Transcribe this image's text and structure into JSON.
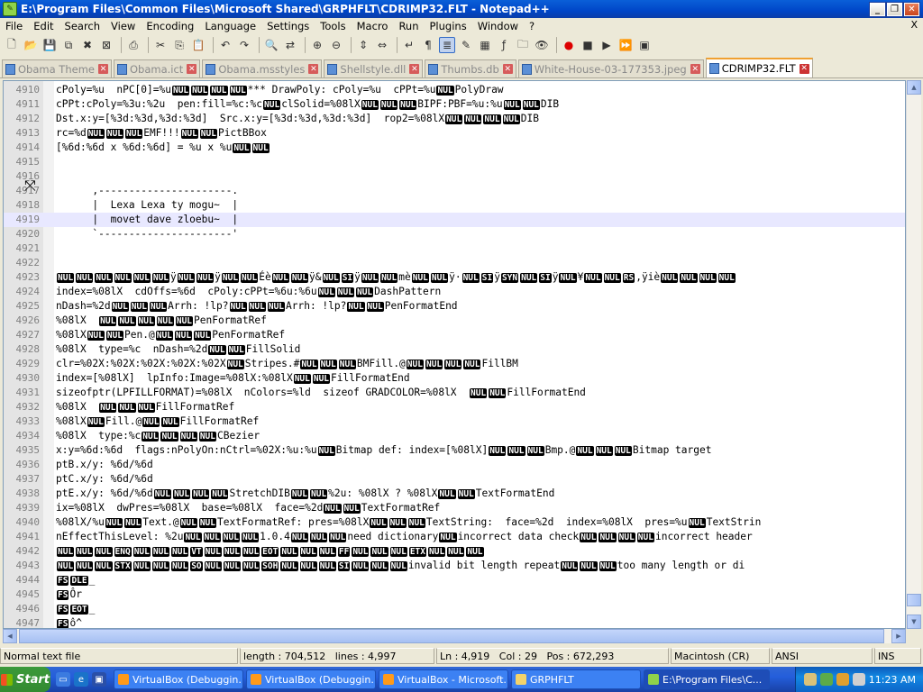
{
  "window": {
    "title": "E:\\Program Files\\Common Files\\Microsoft Shared\\GRPHFLT\\CDRIMP32.FLT - Notepad++",
    "minimize": "_",
    "restore": "❐",
    "close": "✕"
  },
  "menu": {
    "items": [
      "File",
      "Edit",
      "Search",
      "View",
      "Encoding",
      "Language",
      "Settings",
      "Tools",
      "Macro",
      "Run",
      "Plugins",
      "Window",
      "?"
    ],
    "close": "X"
  },
  "toolbar": {
    "icons": [
      "new-file-icon",
      "open-file-icon",
      "save-icon",
      "save-all-icon",
      "close-icon",
      "close-all-icon",
      "print-icon",
      "cut-icon",
      "copy-icon",
      "paste-icon",
      "undo-icon",
      "redo-icon",
      "find-icon",
      "replace-icon",
      "zoom-in-icon",
      "zoom-out-icon",
      "sync-v-icon",
      "sync-h-icon",
      "wrap-icon",
      "all-chars-icon",
      "indent-guide-icon",
      "udl-icon",
      "doc-map-icon",
      "function-list-icon",
      "folder-workspace-icon",
      "monitor-icon",
      "record-macro-icon",
      "stop-macro-icon",
      "play-macro-icon",
      "run-macro-multiple-icon",
      "save-macro-icon"
    ]
  },
  "tabs": [
    {
      "label": "Obama Theme",
      "active": false
    },
    {
      "label": "Obama.ict",
      "active": false
    },
    {
      "label": "Obama.msstyles",
      "active": false
    },
    {
      "label": "Shellstyle.dll",
      "active": false
    },
    {
      "label": "Thumbs.db",
      "active": false
    },
    {
      "label": "White-House-03-177353.jpeg",
      "active": false
    },
    {
      "label": "CDRIMP32.FLT",
      "active": true
    }
  ],
  "editor": {
    "current_line": 4919,
    "lines": [
      {
        "n": "4910",
        "text": "cPoly=%u  nPC[0]=%u⟦NUL⟧⟦NUL⟧⟦NUL⟧⟦NUL⟧*** DrawPoly: cPoly=%u  cPPt=%u⟦NUL⟧PolyDraw"
      },
      {
        "n": "4911",
        "text": "cPPt:cPoly=%3u:%2u  pen:fill=%c:%c⟦NUL⟧clSolid=%08lX⟦NUL⟧⟦NUL⟧⟦NUL⟧BIPF:PBF=%u:%u⟦NUL⟧⟦NUL⟧DIB"
      },
      {
        "n": "4912",
        "text": "Dst.x:y=[%3d:%3d,%3d:%3d]  Src.x:y=[%3d:%3d,%3d:%3d]  rop2=%08lX⟦NUL⟧⟦NUL⟧⟦NUL⟧⟦NUL⟧DIB"
      },
      {
        "n": "4913",
        "text": "rc=%d⟦NUL⟧⟦NUL⟧⟦NUL⟧EMF!!!⟦NUL⟧⟦NUL⟧PictBBox"
      },
      {
        "n": "4914",
        "text": "[%6d:%6d x %6d:%6d] = %u x %u⟦NUL⟧⟦NUL⟧"
      },
      {
        "n": "4915",
        "text": ""
      },
      {
        "n": "4916",
        "text": ""
      },
      {
        "n": "4917",
        "text": "      ,----------------------."
      },
      {
        "n": "4918",
        "text": "      |  Lexa Lexa ty mogu~  |"
      },
      {
        "n": "4919",
        "text": "      |  movet dave zloebu~  |"
      },
      {
        "n": "4920",
        "text": "      `----------------------'"
      },
      {
        "n": "4921",
        "text": ""
      },
      {
        "n": "4922",
        "text": ""
      },
      {
        "n": "4923",
        "text": "⟦NUL⟧⟦NUL⟧⟦NUL⟧⟦NUL⟧⟦NUL⟧⟦NUL⟧ÿ⟦NUL⟧⟦NUL⟧ÿ⟦NUL⟧⟦NUL⟧Éè⟦NUL⟧⟦NUL⟧ÿ&⟦NUL⟧⟦SI⟧ÿ⟦NUL⟧⟦NUL⟧mè⟦NUL⟧⟦NUL⟧ÿ·⟦NUL⟧⟦SI⟧ÿ⟦SYN⟧⟦NUL⟧⟦SI⟧ÿ⟦NUL⟧¥⟦NUL⟧⟦NUL⟧⟦RS⟧,ÿiè⟦NUL⟧⟦NUL⟧⟦NUL⟧⟦NUL⟧"
      },
      {
        "n": "4924",
        "text": "index=%08lX  cdOffs=%6d  cPoly:cPPt=%6u:%6u⟦NUL⟧⟦NUL⟧⟦NUL⟧DashPattern"
      },
      {
        "n": "4925",
        "text": "nDash=%2d⟦NUL⟧⟦NUL⟧⟦NUL⟧Arrh: !lp?⟦NUL⟧⟦NUL⟧⟦NUL⟧Arrh: !lp?⟦NUL⟧⟦NUL⟧PenFormatEnd"
      },
      {
        "n": "4926",
        "text": "%08lX  ⟦NUL⟧⟦NUL⟧⟦NUL⟧⟦NUL⟧⟦NUL⟧PenFormatRef"
      },
      {
        "n": "4927",
        "text": "%08lX⟦NUL⟧⟦NUL⟧Pen.@⟦NUL⟧⟦NUL⟧⟦NUL⟧PenFormatRef"
      },
      {
        "n": "4928",
        "text": "%08lX  type=%c  nDash=%2d⟦NUL⟧⟦NUL⟧FillSolid"
      },
      {
        "n": "4929",
        "text": "clr=%02X:%02X:%02X:%02X:%02X⟦NUL⟧Stripes.#⟦NUL⟧⟦NUL⟧⟦NUL⟧BMFill.@⟦NUL⟧⟦NUL⟧⟦NUL⟧⟦NUL⟧FillBM"
      },
      {
        "n": "4930",
        "text": "index=[%08lX]  lpInfo:Image=%08lX:%08lX⟦NUL⟧⟦NUL⟧FillFormatEnd"
      },
      {
        "n": "4931",
        "text": "sizeofptr(LPFILLFORMAT)=%08lX  nColors=%ld  sizeof GRADCOLOR=%08lX  ⟦NUL⟧⟦NUL⟧FillFormatEnd"
      },
      {
        "n": "4932",
        "text": "%08lX  ⟦NUL⟧⟦NUL⟧⟦NUL⟧FillFormatRef"
      },
      {
        "n": "4933",
        "text": "%08lX⟦NUL⟧Fill.@⟦NUL⟧⟦NUL⟧FillFormatRef"
      },
      {
        "n": "4934",
        "text": "%08lX  type:%c⟦NUL⟧⟦NUL⟧⟦NUL⟧⟦NUL⟧CBezier"
      },
      {
        "n": "4935",
        "text": "x:y=%6d:%6d  flags:nPolyOn:nCtrl=%02X:%u:%u⟦NUL⟧Bitmap def: index=[%08lX]⟦NUL⟧⟦NUL⟧⟦NUL⟧Bmp.@⟦NUL⟧⟦NUL⟧⟦NUL⟧Bitmap target"
      },
      {
        "n": "4936",
        "text": "ptB.x/y: %6d/%6d"
      },
      {
        "n": "4937",
        "text": "ptC.x/y: %6d/%6d"
      },
      {
        "n": "4938",
        "text": "ptE.x/y: %6d/%6d⟦NUL⟧⟦NUL⟧⟦NUL⟧⟦NUL⟧StretchDIB⟦NUL⟧⟦NUL⟧%2u: %08lX ? %08lX⟦NUL⟧⟦NUL⟧TextFormatEnd"
      },
      {
        "n": "4939",
        "text": "ix=%08lX  dwPres=%08lX  base=%08lX  face=%2d⟦NUL⟧⟦NUL⟧TextFormatRef"
      },
      {
        "n": "4940",
        "text": "%08lX/%u⟦NUL⟧⟦NUL⟧Text.@⟦NUL⟧⟦NUL⟧TextFormatRef: pres=%08lX⟦NUL⟧⟦NUL⟧⟦NUL⟧TextString:  face=%2d  index=%08lX  pres=%u⟦NUL⟧TextStrin"
      },
      {
        "n": "4941",
        "text": "nEffectThisLevel: %2u⟦NUL⟧⟦NUL⟧⟦NUL⟧⟦NUL⟧1.0.4⟦NUL⟧⟦NUL⟧⟦NUL⟧need dictionary⟦NUL⟧incorrect data check⟦NUL⟧⟦NUL⟧⟦NUL⟧⟦NUL⟧incorrect header"
      },
      {
        "n": "4942",
        "text": "⟦NUL⟧⟦NUL⟧⟦NUL⟧⟦ENQ⟧⟦NUL⟧⟦NUL⟧⟦NUL⟧⟦VT⟧⟦NUL⟧⟦NUL⟧⟦NUL⟧⟦EOT⟧⟦NUL⟧⟦NUL⟧⟦NUL⟧⟦FF⟧⟦NUL⟧⟦NUL⟧⟦NUL⟧⟦ETX⟧⟦NUL⟧⟦NUL⟧⟦NUL⟧"
      },
      {
        "n": "4943",
        "text": "⟦NUL⟧⟦NUL⟧⟦NUL⟧⟦STX⟧⟦NUL⟧⟦NUL⟧⟦NUL⟧⟦SO⟧⟦NUL⟧⟦NUL⟧⟦NUL⟧⟦SOH⟧⟦NUL⟧⟦NUL⟧⟦NUL⟧⟦SI⟧⟦NUL⟧⟦NUL⟧⟦NUL⟧invalid bit length repeat⟦NUL⟧⟦NUL⟧⟦NUL⟧too many length or di"
      },
      {
        "n": "4944",
        "text": "⟦FS⟧⟦DLE⟧_"
      },
      {
        "n": "4945",
        "text": "⟦FS⟧Ôr"
      },
      {
        "n": "4946",
        "text": "⟦FS⟧⟦EOT⟧_"
      },
      {
        "n": "4947",
        "text": "⟦FS⟧ô^"
      }
    ]
  },
  "statusbar": {
    "file_type": "Normal text file",
    "length": "length : 704,512",
    "lines": "lines : 4,997",
    "ln": "Ln : 4,919",
    "col": "Col : 29",
    "pos": "Pos : 672,293",
    "eol": "Macintosh (CR)",
    "encoding": "ANSI",
    "mode": "INS"
  },
  "taskbar": {
    "start": "Start",
    "tasks": [
      {
        "label": "VirtualBox (Debuggin...",
        "active": false
      },
      {
        "label": "VirtualBox (Debuggin...",
        "active": false
      },
      {
        "label": "VirtualBox - Microsoft...",
        "active": false
      },
      {
        "label": "GRPHFLT",
        "active": false
      },
      {
        "label": "E:\\Program Files\\C...",
        "active": true
      }
    ],
    "clock": "11:23 AM"
  },
  "colors": {
    "ctl_bg": "#000000",
    "current_line_bg": "#e8e8ff",
    "line_number_fg": "#808080"
  }
}
